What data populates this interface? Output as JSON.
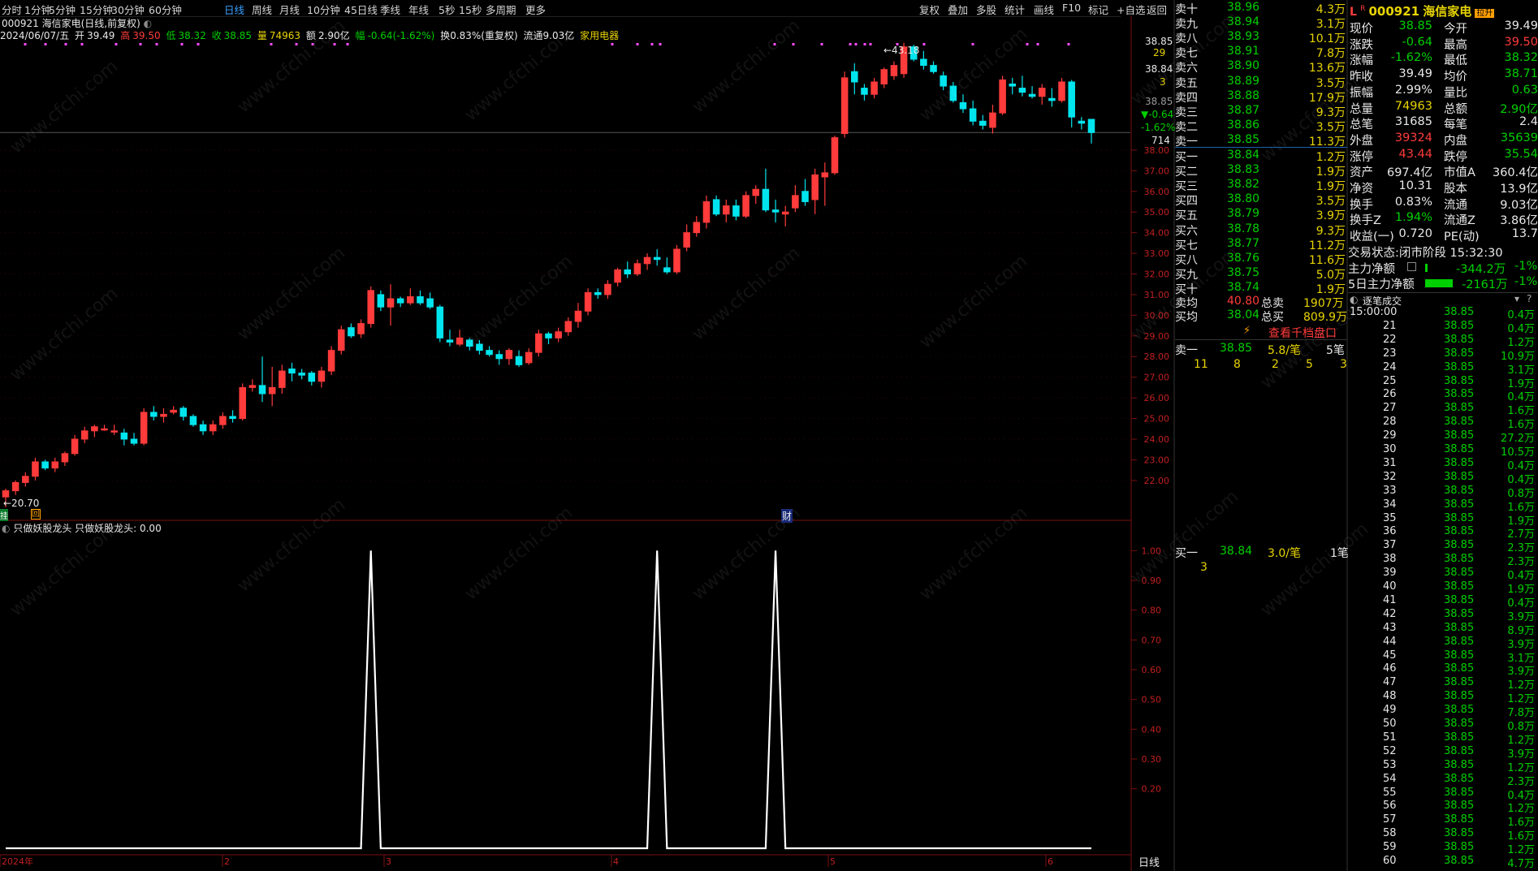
{
  "toolbar": {
    "periods": [
      "分时",
      "1分钟",
      "5分钟",
      "15分钟",
      "30分钟",
      "60分钟",
      "日线",
      "周线",
      "月线",
      "10分钟",
      "45日线",
      "季线",
      "年线",
      "5秒",
      "15秒",
      "多周期",
      "更多"
    ],
    "active": "日线",
    "right_buttons": [
      "复权",
      "叠加",
      "多股",
      "统计",
      "画线",
      "F10",
      "标记",
      "+自选",
      "返回"
    ]
  },
  "header": {
    "code_name": "000921 海信家电(日线,前复权)",
    "date": "2024/06/07/五",
    "open_label": "开",
    "open": "39.49",
    "high_label": "高",
    "high": "39.50",
    "low_label": "低",
    "low": "38.32",
    "close_label": "收",
    "close": "38.85",
    "vol_label": "量",
    "vol": "74963",
    "amount_label": "额",
    "amount": "2.90亿",
    "chg_label": "幅",
    "chg": "-0.64(-1.62%)",
    "turnover": "换0.83%(重复权)",
    "float": "流通9.03亿",
    "industry": "家用电器"
  },
  "price_axis": [
    "38.00",
    "37.00",
    "36.00",
    "35.00",
    "34.00",
    "33.00",
    "32.00",
    "31.00",
    "30.00",
    "29.00",
    "28.00",
    "27.00",
    "26.00",
    "25.00",
    "24.00",
    "23.00",
    "22.00"
  ],
  "top_axis_labels": {
    "top": "38.85",
    "vol": "38.84",
    "n29": "29",
    "n3": "3",
    "n714": "714",
    "p3885": "38.85",
    "chg": "▼-0.64",
    "pct": "-1.62%"
  },
  "markers": {
    "high_label": "←43.18",
    "low_label": "←20.70",
    "cai": "财",
    "gua": "挂",
    "box": "回"
  },
  "indicator": {
    "title": "只做妖股龙头 只做妖股龙头: 0.00",
    "axis": [
      "1.00",
      "0.90",
      "0.80",
      "0.70",
      "0.60",
      "0.50",
      "0.40",
      "0.30",
      "0.20"
    ],
    "bottom_axis": [
      "2024年",
      "2",
      "3",
      "4",
      "5",
      "6"
    ],
    "mode": "日线"
  },
  "chart_data": {
    "type": "candlestick",
    "title": "000921 海信家电(日线,前复权)",
    "ylim": [
      20.5,
      43.5
    ],
    "candles": [
      [
        21.2,
        21.6,
        20.7,
        21.5
      ],
      [
        21.5,
        22.0,
        21.3,
        21.9
      ],
      [
        21.9,
        22.4,
        21.7,
        22.2
      ],
      [
        22.2,
        23.1,
        22.0,
        22.9
      ],
      [
        22.9,
        23.0,
        22.5,
        22.6
      ],
      [
        22.6,
        23.1,
        22.4,
        22.9
      ],
      [
        22.9,
        23.4,
        22.7,
        23.3
      ],
      [
        23.3,
        24.2,
        23.2,
        24.0
      ],
      [
        24.0,
        24.6,
        23.8,
        24.4
      ],
      [
        24.4,
        24.7,
        24.1,
        24.6
      ],
      [
        24.5,
        24.7,
        24.4,
        24.5
      ],
      [
        24.4,
        24.7,
        24.2,
        24.4
      ],
      [
        24.3,
        24.5,
        23.7,
        24.0
      ],
      [
        24.0,
        24.3,
        23.7,
        23.8
      ],
      [
        23.8,
        25.5,
        23.7,
        25.3
      ],
      [
        25.3,
        25.6,
        24.9,
        25.1
      ],
      [
        25.1,
        25.5,
        24.8,
        25.2
      ],
      [
        25.3,
        25.6,
        25.2,
        25.4
      ],
      [
        25.5,
        25.6,
        24.9,
        25.1
      ],
      [
        25.1,
        25.2,
        24.6,
        24.7
      ],
      [
        24.7,
        24.9,
        24.2,
        24.4
      ],
      [
        24.4,
        24.9,
        24.2,
        24.7
      ],
      [
        24.7,
        25.3,
        24.5,
        25.1
      ],
      [
        25.1,
        25.4,
        24.8,
        25.0
      ],
      [
        25.0,
        26.7,
        24.9,
        26.5
      ],
      [
        26.5,
        26.9,
        26.3,
        26.6
      ],
      [
        26.6,
        28.0,
        25.8,
        26.2
      ],
      [
        26.2,
        27.5,
        25.6,
        26.5
      ],
      [
        26.5,
        27.6,
        26.2,
        27.3
      ],
      [
        27.4,
        27.7,
        26.8,
        27.2
      ],
      [
        27.2,
        27.4,
        26.9,
        27.1
      ],
      [
        27.2,
        27.3,
        26.6,
        26.8
      ],
      [
        26.8,
        27.5,
        26.5,
        27.3
      ],
      [
        27.3,
        28.5,
        27.1,
        28.3
      ],
      [
        28.3,
        29.5,
        28.1,
        29.3
      ],
      [
        29.4,
        29.6,
        28.9,
        29.0
      ],
      [
        29.1,
        29.8,
        28.9,
        29.6
      ],
      [
        29.6,
        31.4,
        29.4,
        31.2
      ],
      [
        31.0,
        31.2,
        30.2,
        30.4
      ],
      [
        30.4,
        31.5,
        29.5,
        30.8
      ],
      [
        30.8,
        30.9,
        30.4,
        30.6
      ],
      [
        30.6,
        31.3,
        30.5,
        30.9
      ],
      [
        30.9,
        31.2,
        30.5,
        30.6
      ],
      [
        30.8,
        31.1,
        30.3,
        30.4
      ],
      [
        30.4,
        30.5,
        28.7,
        28.9
      ],
      [
        28.8,
        29.3,
        28.5,
        28.7
      ],
      [
        28.6,
        29.3,
        28.5,
        28.9
      ],
      [
        28.8,
        28.9,
        28.3,
        28.5
      ],
      [
        28.6,
        28.8,
        28.1,
        28.3
      ],
      [
        28.3,
        28.5,
        28.0,
        28.1
      ],
      [
        28.1,
        28.3,
        27.6,
        27.9
      ],
      [
        27.9,
        28.4,
        27.6,
        28.3
      ],
      [
        28.0,
        28.3,
        27.5,
        27.6
      ],
      [
        27.7,
        28.4,
        27.6,
        28.2
      ],
      [
        28.2,
        29.3,
        28.0,
        29.1
      ],
      [
        29.1,
        29.2,
        28.6,
        28.9
      ],
      [
        28.9,
        29.4,
        28.7,
        29.2
      ],
      [
        29.2,
        29.9,
        29.0,
        29.7
      ],
      [
        29.7,
        30.6,
        29.4,
        30.2
      ],
      [
        30.2,
        31.3,
        30.0,
        31.1
      ],
      [
        31.1,
        31.3,
        30.8,
        31.0
      ],
      [
        31.0,
        31.7,
        30.8,
        31.5
      ],
      [
        31.6,
        32.3,
        31.4,
        32.2
      ],
      [
        32.2,
        32.6,
        31.8,
        32.0
      ],
      [
        32.0,
        32.7,
        31.9,
        32.5
      ],
      [
        32.5,
        33.0,
        32.2,
        32.8
      ],
      [
        32.8,
        33.2,
        32.4,
        32.7
      ],
      [
        32.3,
        32.8,
        32.0,
        32.1
      ],
      [
        32.1,
        33.4,
        32.0,
        33.2
      ],
      [
        33.3,
        34.4,
        33.1,
        34.0
      ],
      [
        34.0,
        34.8,
        33.8,
        34.5
      ],
      [
        34.5,
        35.8,
        34.2,
        35.5
      ],
      [
        35.6,
        35.8,
        34.8,
        34.9
      ],
      [
        34.9,
        35.6,
        34.5,
        35.3
      ],
      [
        35.3,
        35.6,
        34.6,
        34.8
      ],
      [
        34.8,
        36.0,
        34.7,
        35.8
      ],
      [
        35.8,
        36.3,
        35.4,
        36.1
      ],
      [
        36.1,
        37.1,
        35.0,
        35.1
      ],
      [
        35.1,
        35.6,
        34.5,
        35.0
      ],
      [
        34.9,
        35.3,
        34.3,
        35.0
      ],
      [
        35.2,
        36.3,
        35.0,
        35.8
      ],
      [
        36.0,
        36.6,
        35.3,
        35.5
      ],
      [
        35.6,
        37.1,
        34.9,
        36.8
      ],
      [
        36.7,
        37.4,
        35.3,
        36.9
      ],
      [
        36.9,
        38.7,
        36.8,
        38.6
      ],
      [
        38.8,
        41.8,
        38.6,
        41.5
      ],
      [
        41.8,
        42.2,
        40.7,
        41.3
      ],
      [
        41.0,
        41.2,
        40.4,
        40.7
      ],
      [
        40.7,
        41.5,
        40.5,
        41.3
      ],
      [
        41.2,
        42.0,
        41.0,
        41.9
      ],
      [
        41.6,
        42.3,
        41.4,
        42.1
      ],
      [
        41.7,
        43.2,
        41.5,
        43.0
      ],
      [
        43.0,
        43.1,
        42.3,
        42.4
      ],
      [
        42.4,
        42.8,
        41.9,
        42.1
      ],
      [
        42.1,
        42.3,
        41.7,
        41.8
      ],
      [
        41.6,
        41.8,
        40.9,
        41.1
      ],
      [
        41.1,
        41.3,
        40.3,
        40.4
      ],
      [
        40.3,
        40.7,
        39.8,
        40.0
      ],
      [
        40.0,
        40.4,
        39.2,
        39.4
      ],
      [
        39.4,
        39.7,
        39.0,
        39.2
      ],
      [
        39.1,
        40.2,
        38.8,
        39.8
      ],
      [
        39.8,
        41.6,
        39.7,
        41.4
      ],
      [
        41.2,
        41.5,
        40.7,
        41.1
      ],
      [
        41.0,
        41.6,
        40.6,
        40.8
      ],
      [
        40.7,
        41.1,
        40.5,
        40.6
      ],
      [
        40.6,
        41.2,
        40.2,
        41.0
      ],
      [
        40.5,
        41.0,
        40.1,
        40.4
      ],
      [
        40.4,
        41.5,
        40.3,
        41.3
      ],
      [
        41.3,
        41.4,
        39.1,
        39.6
      ],
      [
        39.4,
        39.6,
        39.0,
        39.3
      ],
      [
        39.49,
        39.5,
        38.32,
        38.85
      ]
    ],
    "indicator_name": "只做妖股龙头",
    "indicator_spikes_at": [
      37,
      66,
      78
    ],
    "indicator_ylim": [
      0,
      1.05
    ]
  },
  "orderbook": {
    "sell": [
      {
        "label": "卖十",
        "price": "38.96",
        "vol": "4.3万"
      },
      {
        "label": "卖九",
        "price": "38.94",
        "vol": "3.1万"
      },
      {
        "label": "卖八",
        "price": "38.93",
        "vol": "10.1万"
      },
      {
        "label": "卖七",
        "price": "38.91",
        "vol": "7.8万"
      },
      {
        "label": "卖六",
        "price": "38.90",
        "vol": "13.6万"
      },
      {
        "label": "卖五",
        "price": "38.89",
        "vol": "3.5万"
      },
      {
        "label": "卖四",
        "price": "38.88",
        "vol": "17.9万"
      },
      {
        "label": "卖三",
        "price": "38.87",
        "vol": "9.3万"
      },
      {
        "label": "卖二",
        "price": "38.86",
        "vol": "3.5万"
      },
      {
        "label": "卖一",
        "price": "38.85",
        "vol": "11.3万"
      }
    ],
    "buy": [
      {
        "label": "买一",
        "price": "38.84",
        "vol": "1.2万"
      },
      {
        "label": "买二",
        "price": "38.83",
        "vol": "1.9万"
      },
      {
        "label": "买三",
        "price": "38.82",
        "vol": "1.9万"
      },
      {
        "label": "买四",
        "price": "38.80",
        "vol": "3.5万"
      },
      {
        "label": "买五",
        "price": "38.79",
        "vol": "3.9万"
      },
      {
        "label": "买六",
        "price": "38.78",
        "vol": "9.3万"
      },
      {
        "label": "买七",
        "price": "38.77",
        "vol": "11.2万"
      },
      {
        "label": "买八",
        "price": "38.76",
        "vol": "11.6万"
      },
      {
        "label": "买九",
        "price": "38.75",
        "vol": "5.0万"
      },
      {
        "label": "买十",
        "price": "38.74",
        "vol": "1.9万"
      }
    ],
    "avg_sell_label": "卖均",
    "avg_sell": "40.80",
    "total_sell_label": "总卖",
    "total_sell": "1907万",
    "avg_buy_label": "买均",
    "avg_buy": "38.04",
    "total_buy_label": "总买",
    "total_buy": "809.9万",
    "qiandang": "查看千档盘口",
    "sell1_detail": {
      "label": "卖一",
      "price": "38.85",
      "per": "5.8/笔",
      "count": "5笔",
      "queue": [
        "11",
        "8",
        "2",
        "5",
        "3"
      ]
    },
    "buy1_detail": {
      "label": "买一",
      "price": "38.84",
      "per": "3.0/笔",
      "count": "1笔",
      "queue": [
        "3"
      ]
    }
  },
  "quote": {
    "code": "000921",
    "name": "海信家电",
    "badge": "拉升",
    "rows": [
      [
        "现价",
        "38.85",
        "今开",
        "39.49"
      ],
      [
        "涨跌",
        "-0.64",
        "最高",
        "39.50"
      ],
      [
        "涨幅",
        "-1.62%",
        "最低",
        "38.32"
      ],
      [
        "昨收",
        "39.49",
        "均价",
        "38.71"
      ],
      [
        "振幅",
        "2.99%",
        "量比",
        "0.63"
      ],
      [
        "总量",
        "74963",
        "总额",
        "2.90亿"
      ],
      [
        "总笔",
        "31685",
        "每笔",
        "2.4"
      ],
      [
        "外盘",
        "39324",
        "内盘",
        "35639"
      ],
      [
        "涨停",
        "43.44",
        "跌停",
        "35.54"
      ],
      [
        "资产",
        "697.4亿",
        "市值A",
        "360.4亿"
      ],
      [
        "净资",
        "10.31",
        "股本",
        "13.9亿"
      ],
      [
        "换手",
        "0.83%",
        "流通",
        "9.03亿"
      ],
      [
        "换手Z",
        "1.94%",
        "流通Z",
        "3.86亿"
      ],
      [
        "收益(一)",
        "0.720",
        "PE(动)",
        "13.7"
      ]
    ],
    "status_label": "交易状态:",
    "status": "闭市阶段",
    "status_time": "15:32:30",
    "mainflow_label": "主力净额",
    "mainflow": "-344.2万",
    "mainflow_pct": "-1%",
    "mainflow5_label": "5日主力净额",
    "mainflow5": "-2161万",
    "mainflow5_pct": "-1%"
  },
  "trades": {
    "title": "逐笔成交",
    "rows": [
      [
        "15:00:00",
        "38.85",
        "0.4万"
      ],
      [
        "21",
        "38.85",
        "0.4万"
      ],
      [
        "22",
        "38.85",
        "1.2万"
      ],
      [
        "23",
        "38.85",
        "10.9万"
      ],
      [
        "24",
        "38.85",
        "3.1万"
      ],
      [
        "25",
        "38.85",
        "1.9万"
      ],
      [
        "26",
        "38.85",
        "0.4万"
      ],
      [
        "27",
        "38.85",
        "1.6万"
      ],
      [
        "28",
        "38.85",
        "1.6万"
      ],
      [
        "29",
        "38.85",
        "27.2万"
      ],
      [
        "30",
        "38.85",
        "10.5万"
      ],
      [
        "31",
        "38.85",
        "0.4万"
      ],
      [
        "32",
        "38.85",
        "0.4万"
      ],
      [
        "33",
        "38.85",
        "0.8万"
      ],
      [
        "34",
        "38.85",
        "1.6万"
      ],
      [
        "35",
        "38.85",
        "1.9万"
      ],
      [
        "36",
        "38.85",
        "2.7万"
      ],
      [
        "37",
        "38.85",
        "2.3万"
      ],
      [
        "38",
        "38.85",
        "2.3万"
      ],
      [
        "39",
        "38.85",
        "0.4万"
      ],
      [
        "40",
        "38.85",
        "1.9万"
      ],
      [
        "41",
        "38.85",
        "0.4万"
      ],
      [
        "42",
        "38.85",
        "3.9万"
      ],
      [
        "43",
        "38.85",
        "8.9万"
      ],
      [
        "44",
        "38.85",
        "3.9万"
      ],
      [
        "45",
        "38.85",
        "3.1万"
      ],
      [
        "46",
        "38.85",
        "3.9万"
      ],
      [
        "47",
        "38.85",
        "1.2万"
      ],
      [
        "48",
        "38.85",
        "1.2万"
      ],
      [
        "49",
        "38.85",
        "7.8万"
      ],
      [
        "50",
        "38.85",
        "0.8万"
      ],
      [
        "51",
        "38.85",
        "1.2万"
      ],
      [
        "52",
        "38.85",
        "3.9万"
      ],
      [
        "53",
        "38.85",
        "1.2万"
      ],
      [
        "54",
        "38.85",
        "2.3万"
      ],
      [
        "55",
        "38.85",
        "0.4万"
      ],
      [
        "56",
        "38.85",
        "1.2万"
      ],
      [
        "57",
        "38.85",
        "1.6万"
      ],
      [
        "58",
        "38.85",
        "1.6万"
      ],
      [
        "59",
        "38.85",
        "1.2万"
      ],
      [
        "60",
        "38.85",
        "4.7万"
      ]
    ]
  },
  "watermark": "www.cfchi.com",
  "colors": {
    "up": "#ff3b3b",
    "down": "#00e5ee",
    "bg": "#000000",
    "grid": "#6a1212",
    "accent": "#3aa0ff"
  }
}
